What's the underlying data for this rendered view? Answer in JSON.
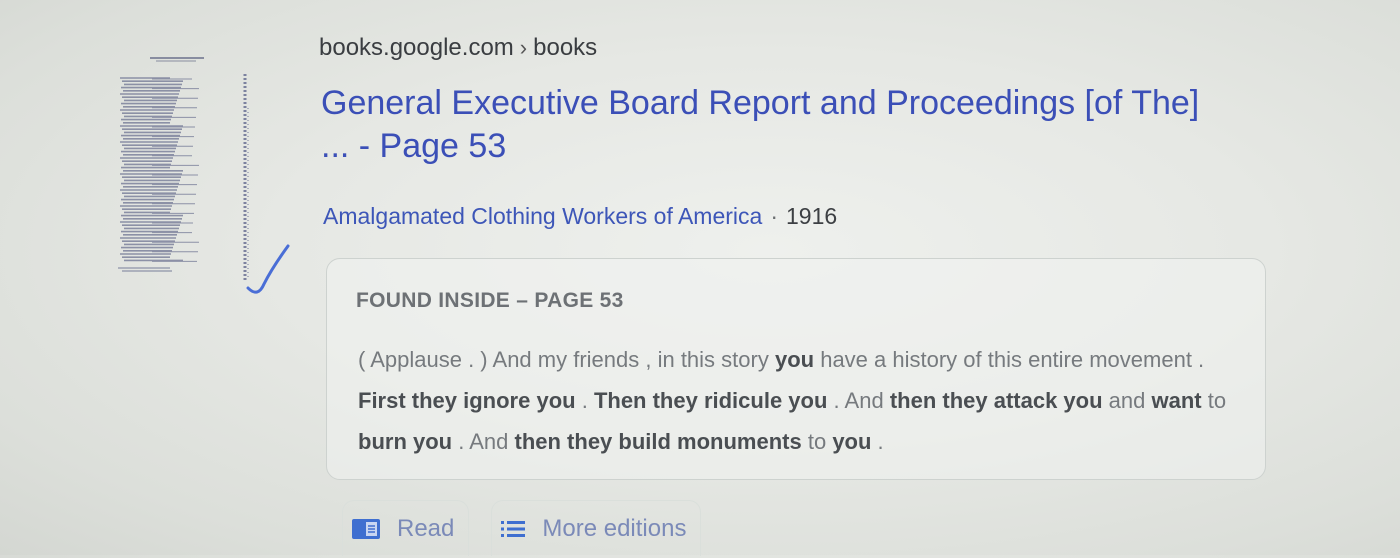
{
  "result": {
    "breadcrumb": {
      "domain": "books.google.com",
      "separator": "›",
      "path": "books"
    },
    "title_line1": "General Executive Board Report and Proceedings [of The]",
    "title_line2": "... - Page 53",
    "author": "Amalgamated Clothing Workers of America",
    "meta_separator": "·",
    "year": "1916",
    "thumbnail_icon": "book-cover-thumbnail"
  },
  "snippet": {
    "heading": "FOUND INSIDE – PAGE 53",
    "segments": [
      {
        "text": "( Applause . ) And my friends , in this story ",
        "bold": false
      },
      {
        "text": "you",
        "bold": true
      },
      {
        "text": " have a history of this entire movement . ",
        "bold": false
      },
      {
        "text": "First they ignore you",
        "bold": true
      },
      {
        "text": " . ",
        "bold": false
      },
      {
        "text": "Then they ridicule you",
        "bold": true
      },
      {
        "text": " . And ",
        "bold": false
      },
      {
        "text": "then they attack you",
        "bold": true
      },
      {
        "text": " and ",
        "bold": false
      },
      {
        "text": "want",
        "bold": true
      },
      {
        "text": " to ",
        "bold": false
      },
      {
        "text": "burn you",
        "bold": true
      },
      {
        "text": " . And ",
        "bold": false
      },
      {
        "text": "then they build monuments",
        "bold": true
      },
      {
        "text": " to ",
        "bold": false
      },
      {
        "text": "you",
        "bold": true
      },
      {
        "text": " .",
        "bold": false
      }
    ]
  },
  "actions": {
    "read_label": "Read",
    "read_icon": "book-open-icon",
    "more_editions_label": "More editions",
    "more_editions_icon": "list-icon"
  },
  "colors": {
    "title": "#3b4fb7",
    "author": "#3d56b8",
    "snippet_text": "#767a7e",
    "snippet_bold": "#4a4e52",
    "action_text": "#7b8ab8",
    "action_icon": "#3f6fd0"
  }
}
